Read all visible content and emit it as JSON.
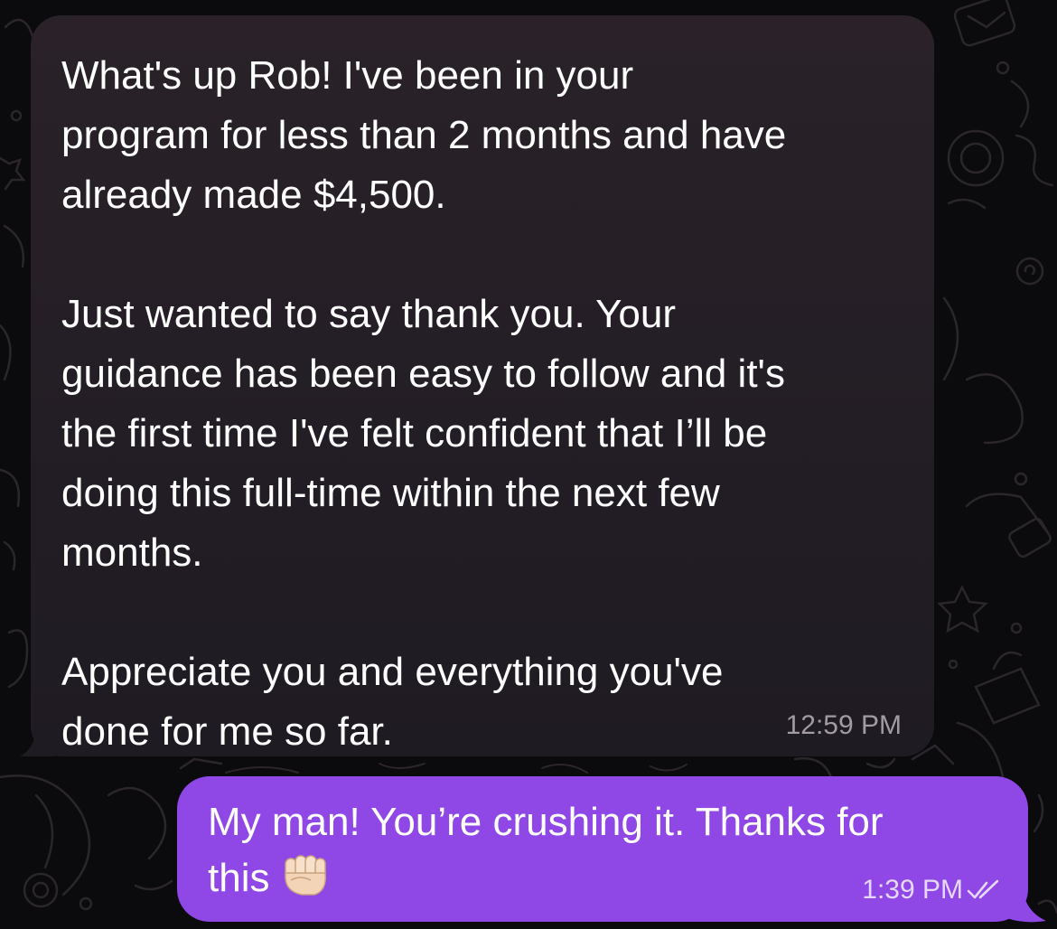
{
  "theme": {
    "incoming_bubble": "#27212a",
    "outgoing_bubble": "#8f47e6",
    "background": "#0b0a0d"
  },
  "messages": {
    "incoming": {
      "paragraphs": [
        "What's up Rob! I've been in your\nprogram for less than 2 months and have\nalready made $4,500.",
        "Just wanted to say thank you. Your\nguidance has been easy to follow and it's\nthe first time I've felt confident that I’ll be\ndoing this full-time within the next few\nmonths.",
        "Appreciate you and everything you've\ndone for me so far."
      ],
      "time": "12:59 PM"
    },
    "outgoing": {
      "text": "My man! You’re crushing it. Thanks for\nthis",
      "emoji": "oncoming-fist",
      "time": "1:39 PM",
      "status_icon": "double-check-icon"
    }
  }
}
